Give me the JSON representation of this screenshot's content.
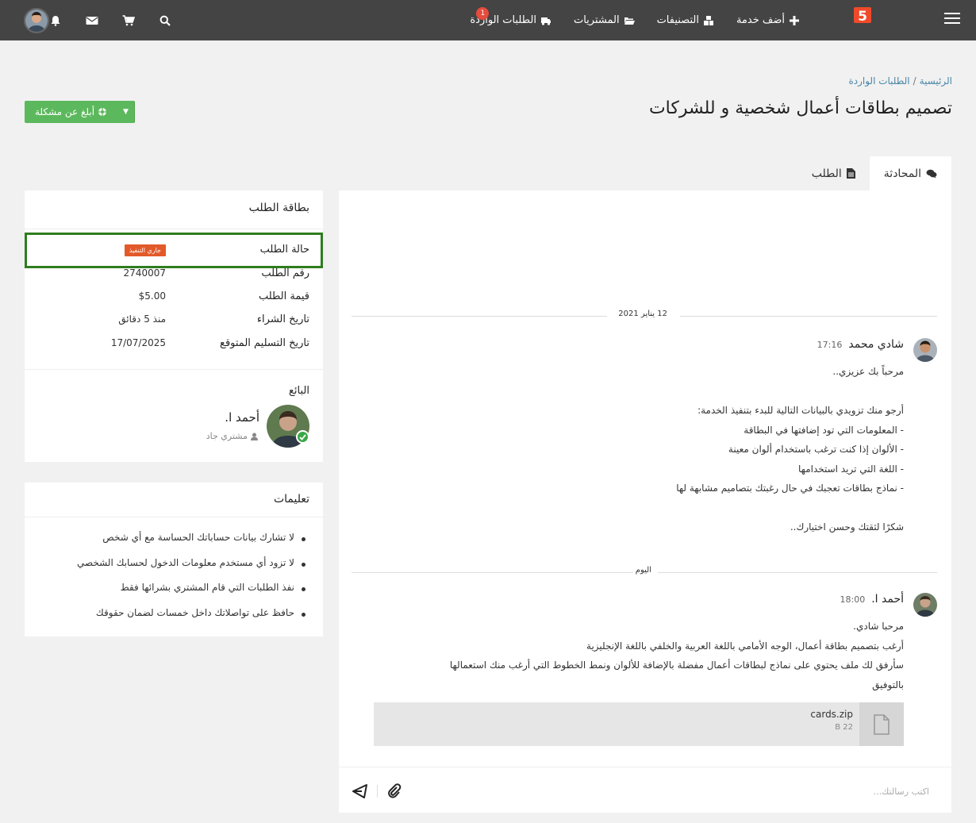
{
  "nav": {
    "items": [
      {
        "label": "أضف خدمة",
        "icon": "plus-icon"
      },
      {
        "label": "التصنيفات",
        "icon": "cubes-icon"
      },
      {
        "label": "المشتريات",
        "icon": "folder-open-icon"
      },
      {
        "label": "الطلبات الواردة",
        "icon": "truck-icon",
        "badge": "1"
      }
    ],
    "tools": [
      "search-icon",
      "cart-icon",
      "envelope-icon",
      "bell-icon"
    ]
  },
  "breadcrumb": {
    "home": "الرئيسية",
    "separator": "/",
    "current": "الطلبات الواردة"
  },
  "page": {
    "title": "تصميم بطاقات أعمال شخصية و للشركات",
    "report_label": "أبلغ عن مشكلة"
  },
  "tabs": [
    {
      "label": "المحادثة",
      "icon": "comments-icon",
      "active": true
    },
    {
      "label": "الطلب",
      "icon": "file-icon",
      "active": false
    }
  ],
  "chat": {
    "separators": [
      "12 يناير 2021",
      "اليوم"
    ],
    "messages": [
      {
        "name": "شادي محمد",
        "time": "17:16",
        "lines": [
          "مرحباً بك عزيزي..",
          "",
          "أرجو منك تزويدي بالبيانات التالية للبدء بتنفيذ الخدمة:",
          "- المعلومات التي تود إضافتها في البطاقة",
          "- الألوان إذا كنت ترغب باستخدام ألوان معينة",
          "- اللغة التي تريد استخدامها",
          "- نماذج بطاقات تعجبك في حال رغبتك بتصاميم مشابهة لها",
          "",
          "شكرًا لثقتك وحسن اختيارك.."
        ]
      },
      {
        "name": "أحمد ا.",
        "time": "18:00",
        "lines": [
          "مرحبا شادي.",
          "أرغب بتصميم بطاقة أعمال، الوجه الأمامي باللغة العربية والخلفي باللغة الإنجليزية",
          "سأرفق لك ملف يحتوي على نماذج لبطاقات أعمال مفضلة بالإضافة للألوان ونمط الخطوط التي أرغب منك استعمالها",
          "بالتوفيق"
        ]
      }
    ],
    "attachment": {
      "name": "cards.zip",
      "size": "22 B"
    },
    "composer_placeholder": "اكتب رسالتك..."
  },
  "order_card": {
    "title": "بطاقة الطلب",
    "rows": [
      {
        "label": "حالة الطلب",
        "value": "جاري التنفيذ"
      },
      {
        "label": "رقم الطلب",
        "value": "2740007"
      },
      {
        "label": "قيمة الطلب",
        "value": "$5.00"
      },
      {
        "label": "تاريخ الشراء",
        "value": "منذ 5 دقائق"
      },
      {
        "label": "تاريخ التسليم المتوقع",
        "value": "17/07/2025"
      }
    ],
    "seller_label": "البائع",
    "seller_name": "أحمد ا.",
    "seller_role": "مشتري جاد"
  },
  "instructions": {
    "title": "تعليمات",
    "items": [
      "لا تشارك بيانات حساباتك الحساسة مع أي شخص",
      "لا تزود أي مستخدم معلومات الدخول لحسابك الشخصي",
      "نفذ الطلبات التي قام المشتري بشرائها فقط",
      "حافظ على تواصلاتك داخل خمسات لضمان حقوقك"
    ]
  },
  "colors": {
    "topbar": "#444444",
    "report_button": "#5cb85c",
    "status_badge": "#e25a2a",
    "status_highlight": "#2e7d1e",
    "notification_badge": "#e64b3c"
  }
}
